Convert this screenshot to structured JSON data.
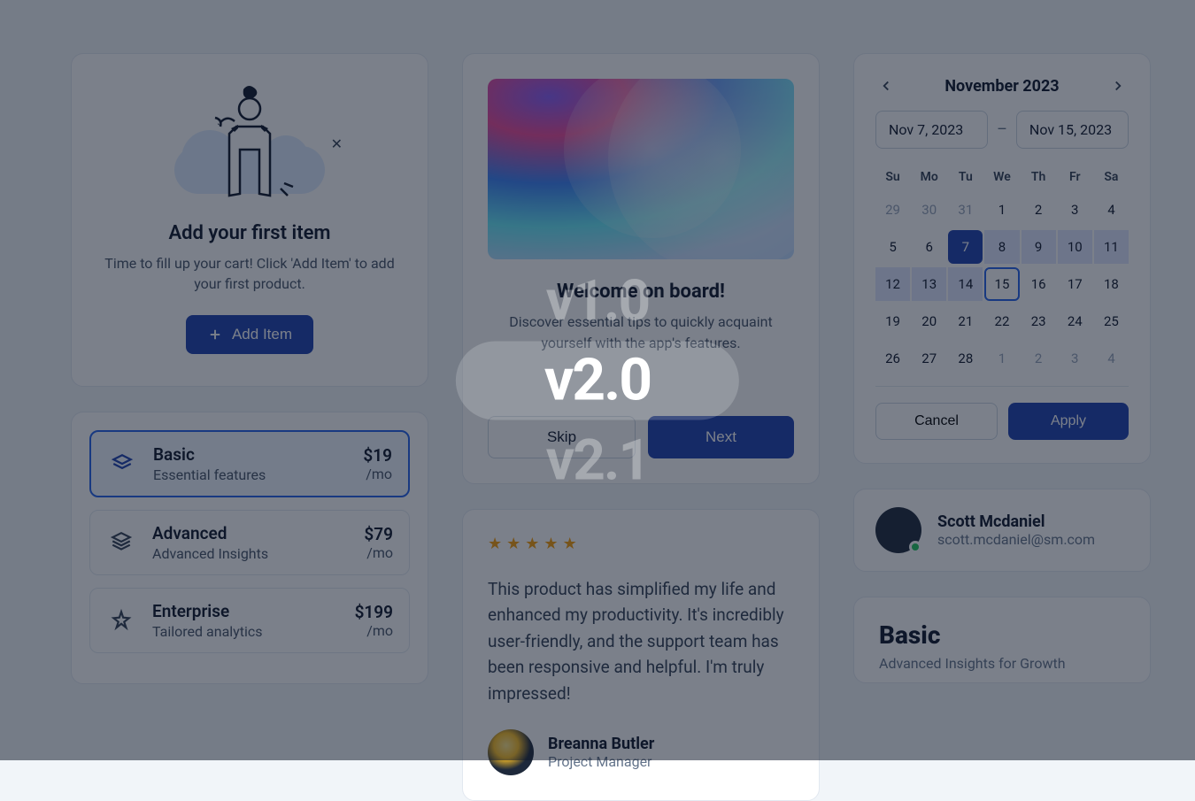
{
  "empty": {
    "title": "Add your first item",
    "subtitle": "Time to fill up your cart! Click 'Add Item' to add your first product.",
    "cta": "Add Item"
  },
  "plans": [
    {
      "name": "Basic",
      "desc": "Essential features",
      "price": "$19",
      "per": "/mo",
      "selected": true
    },
    {
      "name": "Advanced",
      "desc": "Advanced Insights",
      "price": "$79",
      "per": "/mo",
      "selected": false
    },
    {
      "name": "Enterprise",
      "desc": "Tailored analytics",
      "price": "$199",
      "per": "/mo",
      "selected": false
    }
  ],
  "onboard": {
    "title": "Welcome on board!",
    "subtitle": "Discover essential tips to quickly acquaint yourself with the app's features.",
    "skip": "Skip",
    "next": "Next"
  },
  "testi": {
    "stars": 5,
    "text": "This product has simplified my life and enhanced my productivity. It's incredibly user-friendly, and the support team has been responsive and helpful. I'm truly impressed!",
    "author": "Breanna Butler",
    "role": "Project Manager"
  },
  "calendar": {
    "month": "November 2023",
    "start": "Nov 7, 2023",
    "end": "Nov 15, 2023",
    "dow": [
      "Su",
      "Mo",
      "Tu",
      "We",
      "Th",
      "Fr",
      "Sa"
    ],
    "days": [
      {
        "n": "29",
        "muted": true
      },
      {
        "n": "30",
        "muted": true
      },
      {
        "n": "31",
        "muted": true
      },
      {
        "n": "1"
      },
      {
        "n": "2"
      },
      {
        "n": "3"
      },
      {
        "n": "4"
      },
      {
        "n": "5"
      },
      {
        "n": "6"
      },
      {
        "n": "7",
        "start": true
      },
      {
        "n": "8",
        "range": true
      },
      {
        "n": "9",
        "range": true
      },
      {
        "n": "10",
        "range": true
      },
      {
        "n": "11",
        "range": true
      },
      {
        "n": "12",
        "range": true
      },
      {
        "n": "13",
        "range": true
      },
      {
        "n": "14",
        "range": true
      },
      {
        "n": "15",
        "end": true
      },
      {
        "n": "16"
      },
      {
        "n": "17"
      },
      {
        "n": "18"
      },
      {
        "n": "19"
      },
      {
        "n": "20"
      },
      {
        "n": "21"
      },
      {
        "n": "22"
      },
      {
        "n": "23"
      },
      {
        "n": "24"
      },
      {
        "n": "25"
      },
      {
        "n": "26"
      },
      {
        "n": "27"
      },
      {
        "n": "28"
      },
      {
        "n": "1",
        "muted": true
      },
      {
        "n": "2",
        "muted": true
      },
      {
        "n": "3",
        "muted": true
      },
      {
        "n": "4",
        "muted": true
      }
    ],
    "cancel": "Cancel",
    "apply": "Apply"
  },
  "user": {
    "name": "Scott Mcdaniel",
    "email": "scott.mcdaniel@sm.com"
  },
  "basic": {
    "title": "Basic",
    "subtitle": "Advanced Insights for Growth"
  },
  "versions": {
    "items": [
      "v1.0",
      "v2.0",
      "v2.1"
    ],
    "active": 1
  }
}
